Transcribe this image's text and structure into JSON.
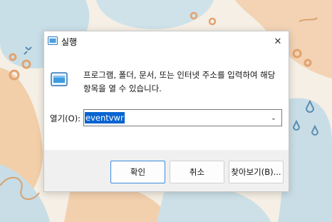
{
  "dialog": {
    "title": "실행",
    "close_symbol": "✕",
    "description": "프로그램, 폴더, 문서, 또는 인터넷 주소를 입력하여 해당 항목을 열 수 있습니다.",
    "open_label": "열기(O):",
    "open_value": "eventvwr",
    "dropdown_symbol": "⌄",
    "buttons": {
      "ok": "확인",
      "cancel": "취소",
      "browse": "찾아보기(B)..."
    }
  },
  "icons": {
    "title": "run-app-icon",
    "main": "run-app-icon",
    "close": "close-icon",
    "dropdown": "chevron-down-icon"
  },
  "colors": {
    "selection": "#0a64d0",
    "primary_button_border": "#3c8be0",
    "dialog_background": "#f0f0f0"
  }
}
